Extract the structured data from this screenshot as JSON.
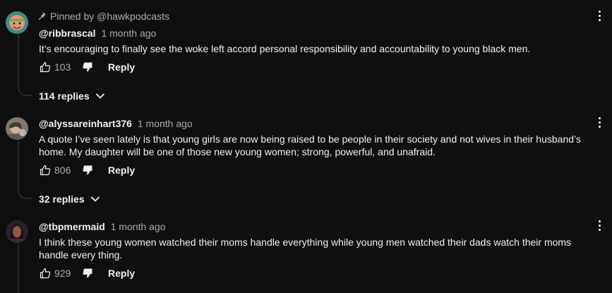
{
  "colors": {
    "background": "#0f0f0f",
    "primary_text": "#f1f1f1",
    "secondary_text": "#aaaaaa",
    "thread_line": "#2a2a2a"
  },
  "comments": [
    {
      "pinned_label": "Pinned by @hawkpodcasts",
      "author": "@ribbrascal",
      "timestamp": "1 month ago",
      "text": "It’s encouraging to finally see the woke left accord personal responsibility and accountability to young black men.",
      "likes": "103",
      "reply_label": "Reply",
      "replies_label": "114 replies",
      "icons": [
        "pin-icon",
        "thumbs-up-icon",
        "thumbs-down-icon",
        "chevron-down-icon",
        "more-vert-icon"
      ]
    },
    {
      "author": "@alyssareinhart376",
      "timestamp": "1 month ago",
      "text": "A quote I’ve seen lately is that young girls are now being raised to be people in their society and not wives in their husband’s home. My daughter will be one of those new young women; strong, powerful, and unafraid.",
      "likes": "806",
      "reply_label": "Reply",
      "replies_label": "32 replies"
    },
    {
      "author": "@tbpmermaid",
      "timestamp": "1 month ago",
      "text": "I think these young women watched their moms handle everything while young men watched their dads watch their moms handle every thing.",
      "likes": "929",
      "reply_label": "Reply"
    }
  ]
}
